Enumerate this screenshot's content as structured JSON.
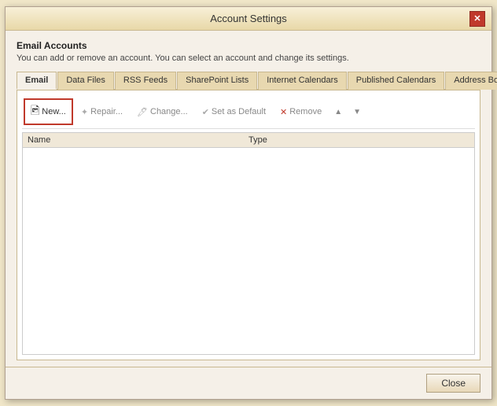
{
  "dialog": {
    "title": "Account Settings",
    "close_label": "✕"
  },
  "header": {
    "title": "Email Accounts",
    "description": "You can add or remove an account. You can select an account and change its settings."
  },
  "tabs": [
    {
      "id": "email",
      "label": "Email",
      "active": true
    },
    {
      "id": "data-files",
      "label": "Data Files",
      "active": false
    },
    {
      "id": "rss-feeds",
      "label": "RSS Feeds",
      "active": false
    },
    {
      "id": "sharepoint-lists",
      "label": "SharePoint Lists",
      "active": false
    },
    {
      "id": "internet-calendars",
      "label": "Internet Calendars",
      "active": false
    },
    {
      "id": "published-calendars",
      "label": "Published Calendars",
      "active": false
    },
    {
      "id": "address-books",
      "label": "Address Books",
      "active": false
    }
  ],
  "toolbar": {
    "new_label": "New...",
    "repair_label": "Repair...",
    "change_label": "Change...",
    "set_default_label": "Set as Default",
    "remove_label": "Remove",
    "move_up_icon": "▲",
    "move_down_icon": "▼"
  },
  "table": {
    "col_name": "Name",
    "col_type": "Type"
  },
  "footer": {
    "close_label": "Close"
  }
}
